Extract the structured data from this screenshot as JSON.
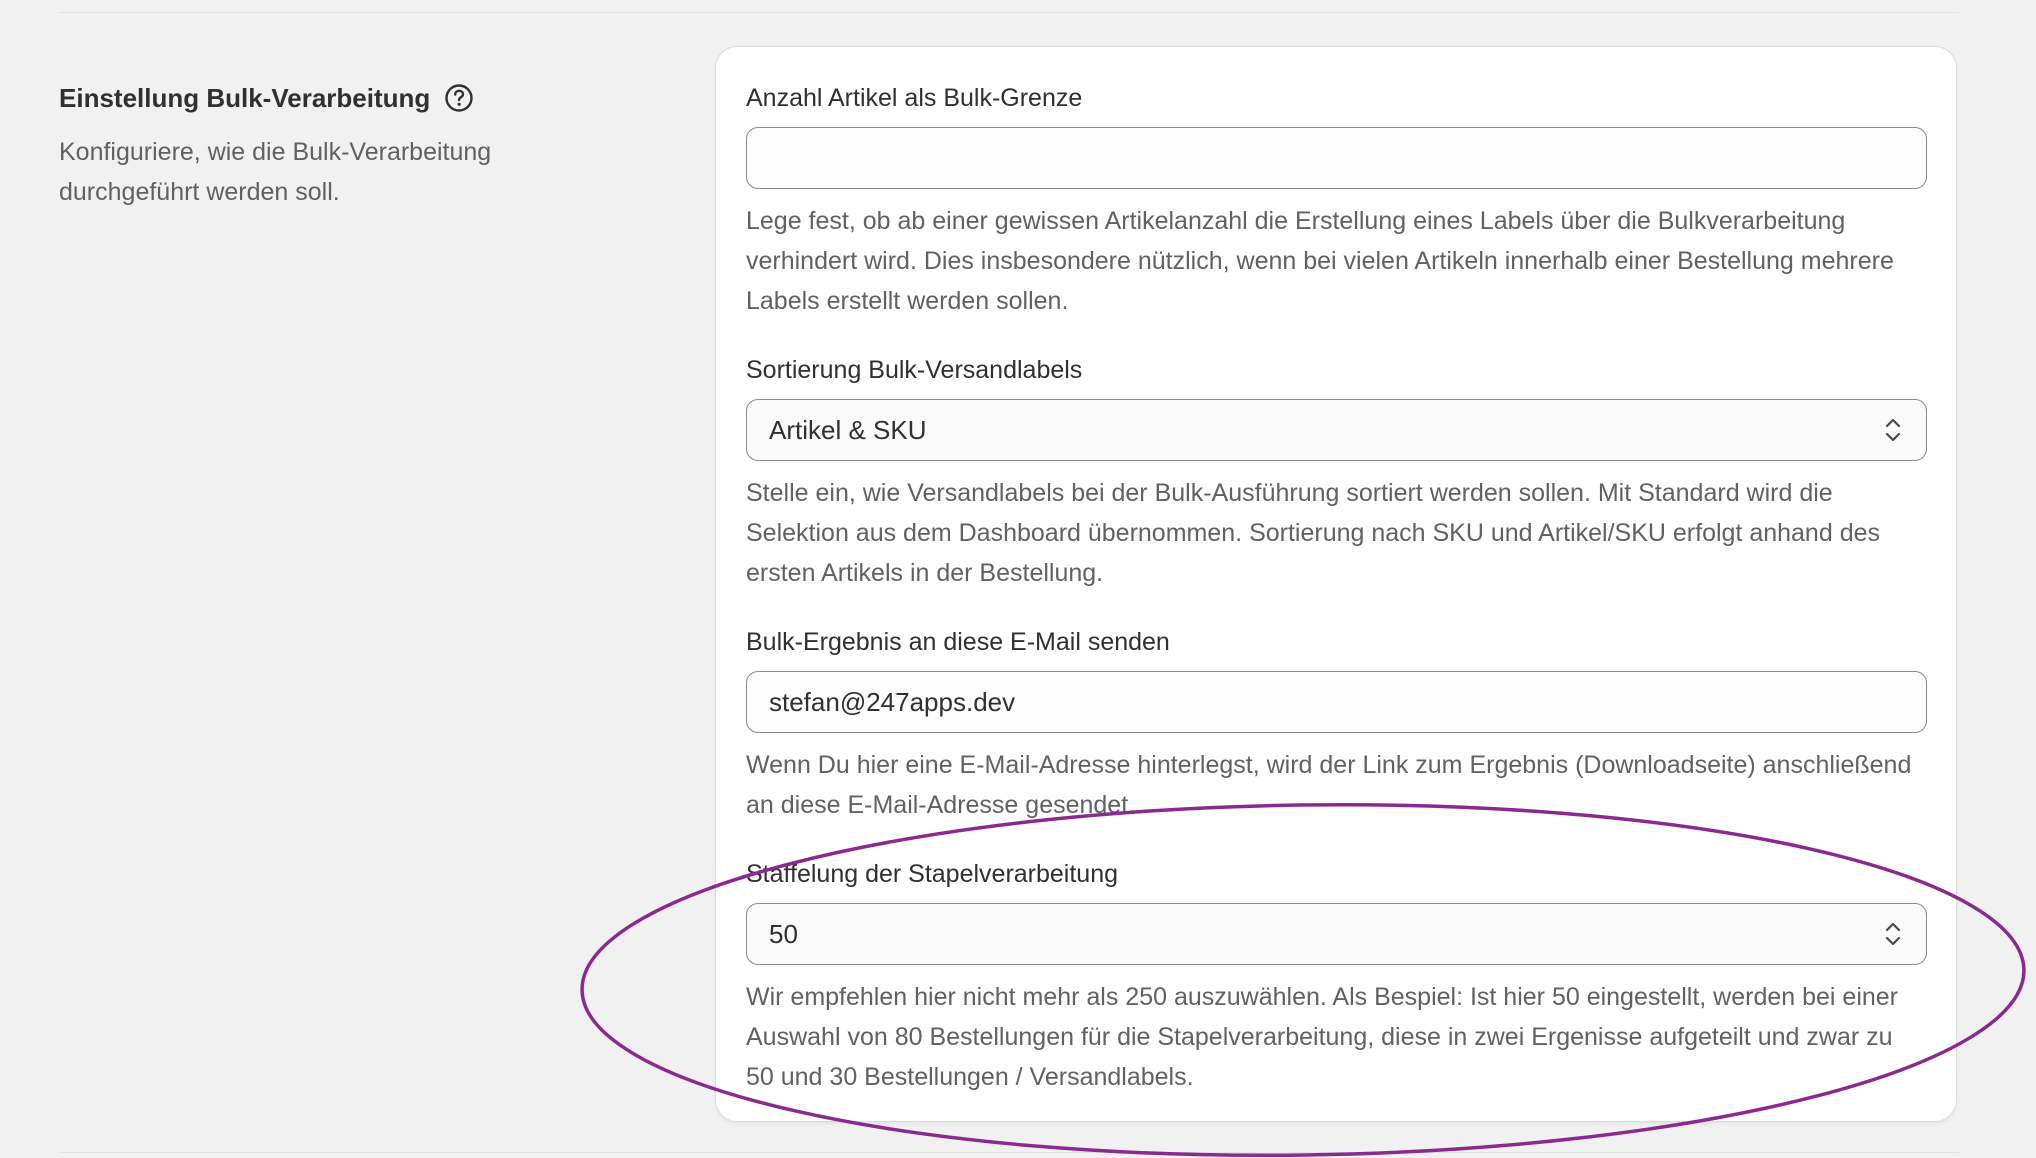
{
  "section": {
    "title": "Einstellung Bulk-Verarbeitung",
    "description": "Konfiguriere, wie die Bulk-Verarbeitung durchgeführt werden soll."
  },
  "fields": {
    "bulk_limit": {
      "label": "Anzahl Artikel als Bulk-Grenze",
      "value": "",
      "help": "Lege fest, ob ab einer gewissen Artikelanzahl die Erstellung eines Labels über die Bulkverarbeitung verhindert wird. Dies insbesondere nützlich, wenn bei vielen Artikeln innerhalb einer Bestellung mehrere Labels erstellt werden sollen."
    },
    "sorting": {
      "label": "Sortierung Bulk-Versandlabels",
      "value": "Artikel & SKU",
      "help": "Stelle ein, wie Versandlabels bei der Bulk-Ausführung sortiert werden sollen. Mit Standard wird die Selektion aus dem Dashboard übernommen. Sortierung nach SKU und Artikel/SKU erfolgt anhand des ersten Artikels in der Bestellung."
    },
    "email": {
      "label": "Bulk-Ergebnis an diese E-Mail senden",
      "value": "stefan@247apps.dev",
      "help": "Wenn Du hier eine E-Mail-Adresse hinterlegst, wird der Link zum Ergebnis (Downloadseite) anschließend an diese E-Mail-Adresse gesendet."
    },
    "batch_size": {
      "label": "Staffelung der Stapelverarbeitung",
      "value": "50",
      "help": "Wir empfehlen hier nicht mehr als 250 auszuwählen. Als Bespiel: Ist hier 50 eingestellt, werden bei einer Auswahl von 80 Bestellungen für die Stapelverarbeitung, diese in zwei Ergenisse aufgeteilt und zwar zu 50 und 30 Bestellungen / Versandlabels."
    }
  },
  "icons": {
    "help": "question-circle-icon",
    "select": "chevron-up-down-icon"
  },
  "colors": {
    "annotation": "#8b2a8e",
    "background": "#f1f1f1",
    "card": "#ffffff"
  }
}
